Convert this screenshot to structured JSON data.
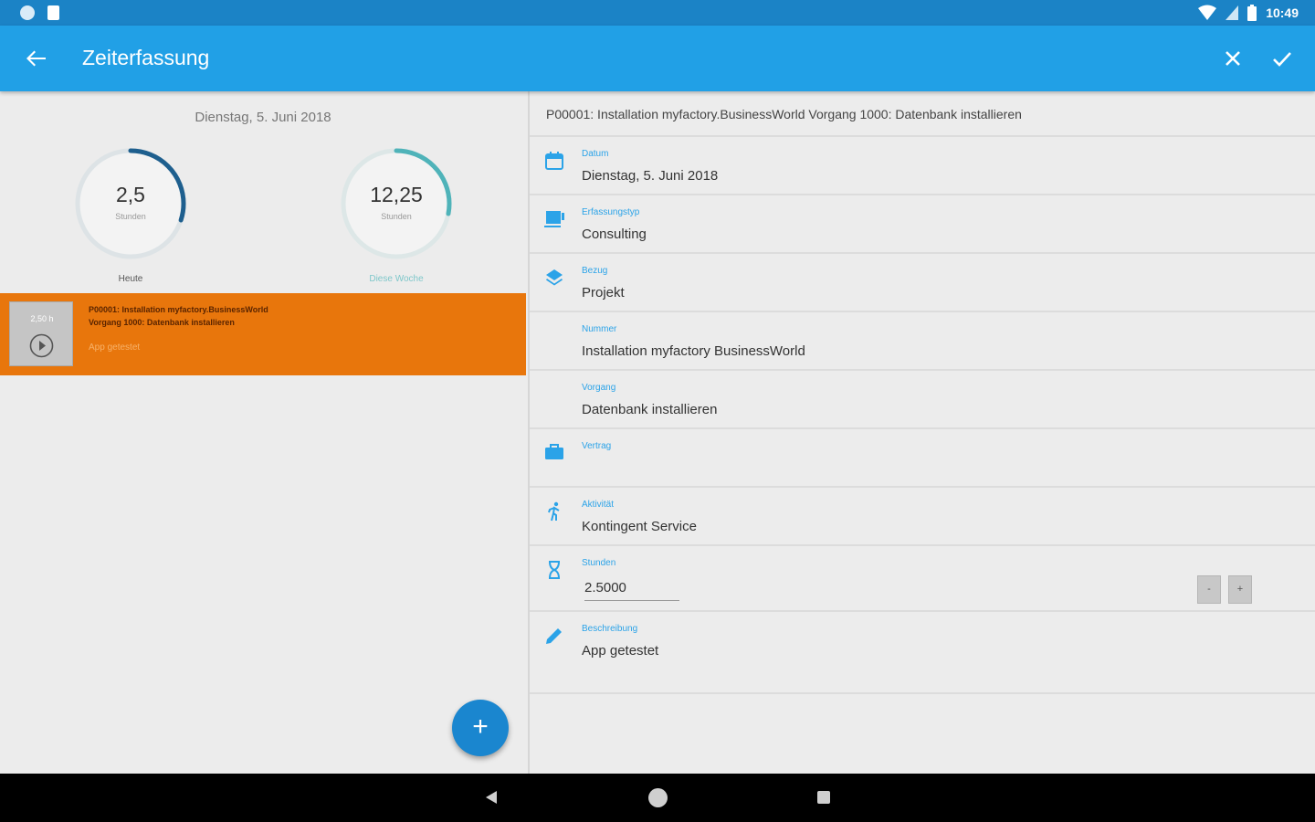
{
  "status_bar": {
    "time": "10:49",
    "icons": [
      "circle-notification-icon",
      "sd-card-icon",
      "wifi-icon",
      "signal-icon",
      "battery-icon"
    ]
  },
  "app_bar": {
    "title": "Zeiterfassung",
    "icons": [
      "back-arrow-icon",
      "close-icon",
      "check-icon"
    ]
  },
  "left": {
    "date": "Dienstag, 5. Juni 2018",
    "gauges": [
      {
        "value": "2,5",
        "unit": "Stunden",
        "label": "Heute",
        "fraction": 0.3,
        "color": "#1e5f8e"
      },
      {
        "value": "12,25",
        "unit": "Stunden",
        "label": "Diese Woche",
        "fraction": 0.28,
        "color": "#4fb3b9"
      }
    ],
    "entry": {
      "hours": "2,50 h",
      "line1": "P00001: Installation myfactory.BusinessWorld",
      "line2": "Vorgang 1000: Datenbank installieren",
      "desc": "App getestet",
      "color": "#e8760c"
    },
    "fab": "+"
  },
  "right": {
    "header": "P00001: Installation myfactory.BusinessWorld  Vorgang 1000: Datenbank installieren",
    "fields": {
      "datum": {
        "label": "Datum",
        "value": "Dienstag, 5. Juni 2018",
        "icon": "calendar-icon"
      },
      "erfassungstyp": {
        "label": "Erfassungstyp",
        "value": "Consulting",
        "icon": "type-icon"
      },
      "bezug": {
        "label": "Bezug",
        "value": "Projekt",
        "icon": "layers-icon"
      },
      "nummer": {
        "label": "Nummer",
        "value": "Installation myfactory BusinessWorld"
      },
      "vorgang": {
        "label": "Vorgang",
        "value": "Datenbank installieren"
      },
      "vertrag": {
        "label": "Vertrag",
        "value": "",
        "icon": "briefcase-icon"
      },
      "aktivitaet": {
        "label": "Aktivität",
        "value": "Kontingent Service",
        "icon": "running-icon"
      },
      "stunden": {
        "label": "Stunden",
        "value": "2.5000",
        "minus": "-",
        "plus": "+",
        "icon": "hourglass-icon"
      },
      "beschreibung": {
        "label": "Beschreibung",
        "value": "App getestet",
        "icon": "pencil-icon"
      }
    }
  },
  "colors": {
    "status_bar": "#1b83c6",
    "app_bar": "#21a0e6",
    "accent": "#2ba3e8",
    "entry": "#e8760c",
    "fab": "#1a86cf"
  }
}
